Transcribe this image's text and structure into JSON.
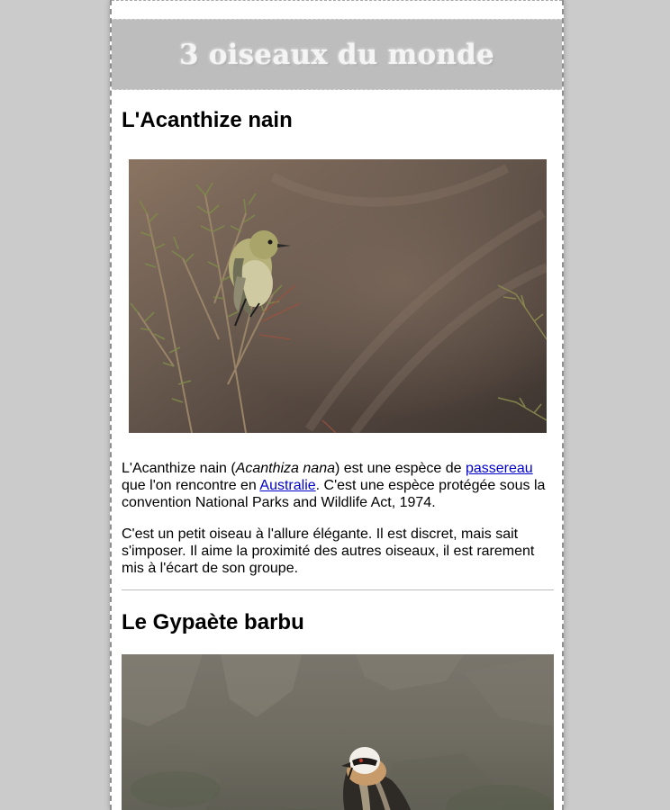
{
  "header": {
    "title": "3 oiseaux du monde"
  },
  "sections": [
    {
      "heading": "L'Acanthize nain",
      "image_alt": "Acanthize nain perché sur une branche",
      "paragraph1": {
        "t1": "L'Acanthize nain (",
        "latin": "Acanthiza nana",
        "t2": ") est une espèce de ",
        "link1": "passereau",
        "t3": " que l'on rencontre en ",
        "link2": "Australie",
        "t4": ". C'est une espèce protégée sous la convention National Parks and Wildlife Act, 1974."
      },
      "paragraph2": "C'est un petit oiseau à l'allure élégante. Il est discret, mais sait s'imposer. Il aime la proximité des autres oiseaux, il est rarement mis à l'écart de son groupe."
    },
    {
      "heading": "Le Gypaète barbu",
      "image_alt": "Gypaète barbu"
    }
  ],
  "colors": {
    "background": "#cbcbcb",
    "banner": "#bdbdbd",
    "link": "#0000cc"
  }
}
